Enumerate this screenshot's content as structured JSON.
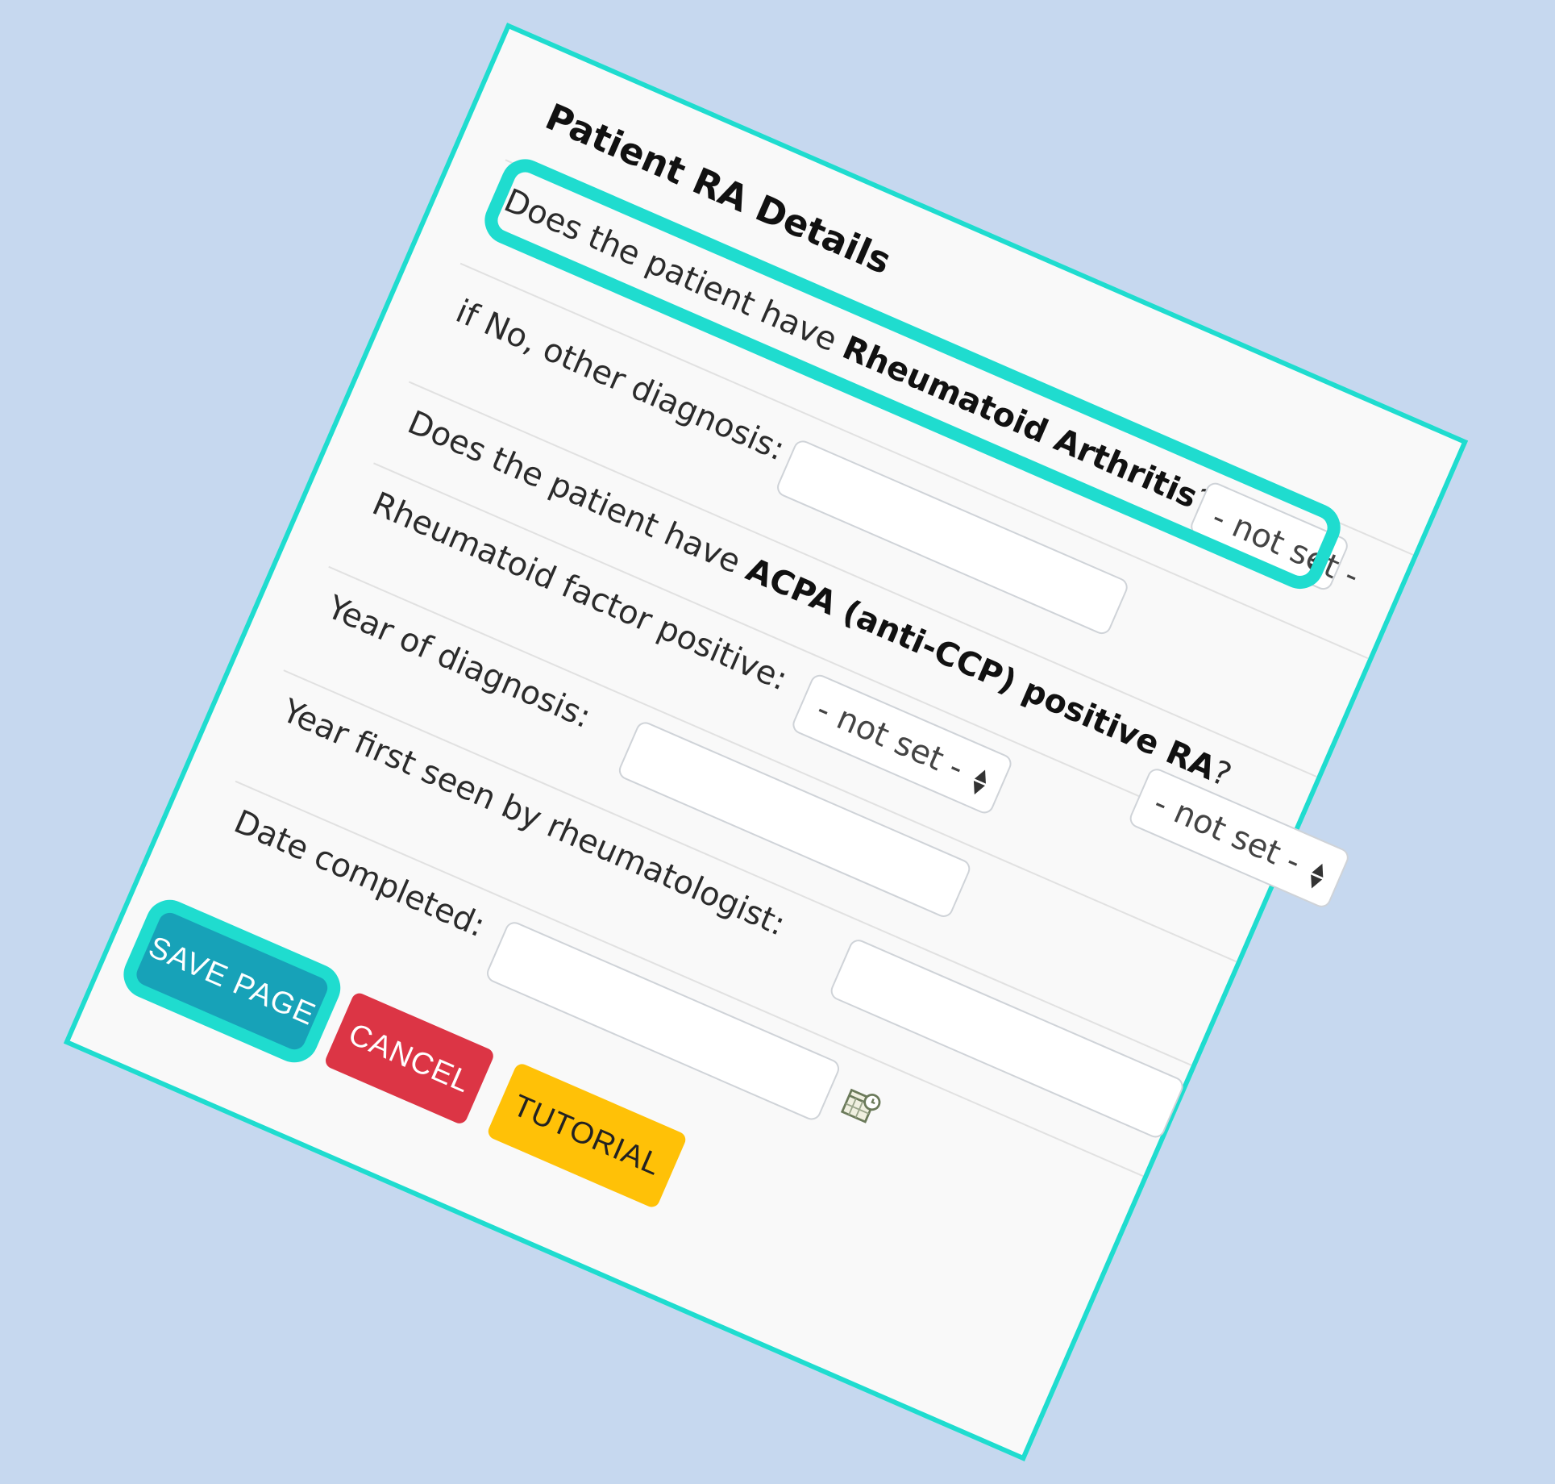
{
  "form": {
    "title": "Patient RA Details",
    "questions": {
      "ra": {
        "prefix": "Does the patient have ",
        "bold": "Rheumatoid Arthritis",
        "suffix": "?",
        "select_value": "- not set -"
      },
      "other_diagnosis": {
        "label": "if No, other diagnosis:",
        "value": ""
      },
      "acpa": {
        "prefix": "Does the patient have ",
        "bold": "ACPA (anti-CCP) positive RA",
        "suffix": "?",
        "select_value": "- not set -"
      },
      "rf": {
        "label": "Rheumatoid factor positive:",
        "select_value": "- not set -"
      },
      "year_diagnosis": {
        "label": "Year of diagnosis:",
        "value": ""
      },
      "year_first_seen": {
        "label": "Year first seen by rheumatologist:",
        "value": ""
      },
      "date_completed": {
        "label": "Date completed:",
        "value": "",
        "icon": "calendar-icon"
      }
    },
    "buttons": {
      "save": "SAVE PAGE",
      "cancel": "CANCEL",
      "tutorial": "TUTORIAL"
    }
  },
  "colors": {
    "highlight": "#1fdccf",
    "save": "#17a2b8",
    "cancel": "#dc3545",
    "tutorial": "#ffc107",
    "background": "#c6d8ef"
  }
}
